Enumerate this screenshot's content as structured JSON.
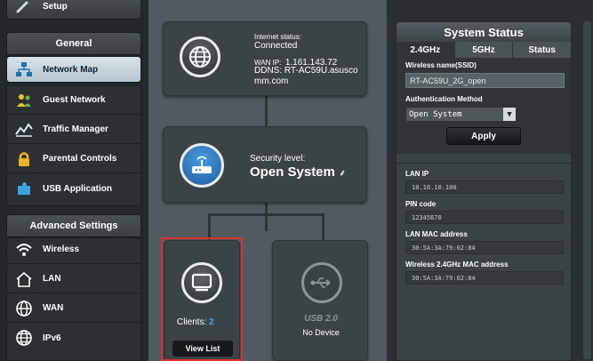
{
  "sidebar": {
    "setup_label": "Setup",
    "general_header": "General",
    "general_items": [
      {
        "label": "Network Map",
        "icon": "network-map-icon"
      },
      {
        "label": "Guest Network",
        "icon": "guest-network-icon"
      },
      {
        "label": "Traffic Manager",
        "icon": "traffic-manager-icon"
      },
      {
        "label": "Parental Controls",
        "icon": "parental-controls-icon"
      },
      {
        "label": "USB Application",
        "icon": "usb-application-icon"
      }
    ],
    "advanced_header": "Advanced Settings",
    "advanced_items": [
      {
        "label": "Wireless",
        "icon": "wireless-icon"
      },
      {
        "label": "LAN",
        "icon": "lan-icon"
      },
      {
        "label": "WAN",
        "icon": "wan-icon"
      },
      {
        "label": "IPv6",
        "icon": "ipv6-icon"
      }
    ]
  },
  "map": {
    "internet": {
      "status_label": "Internet status:",
      "status_value": "Connected",
      "wan_ip_label": "WAN IP:",
      "wan_ip_value": "1.161.143.72",
      "ddns_line1": "DDNS: RT-AC59U.asusco",
      "ddns_line2": "mm.com"
    },
    "router": {
      "security_label": "Security level:",
      "security_value": "Open System"
    },
    "clients": {
      "label": "Clients:",
      "count": "2",
      "view_list_label": "View List"
    },
    "usb": {
      "badge": "USB 2.0",
      "status": "No Device"
    }
  },
  "status": {
    "title": "System Status",
    "tabs": [
      "2.4GHz",
      "5GHz",
      "Status"
    ],
    "ssid_label": "Wireless name(SSID)",
    "ssid_value": "RT-AC59U_2G_open",
    "auth_label": "Authentication Method",
    "auth_value": "Open System",
    "apply_label": "Apply",
    "lan_ip_label": "LAN IP",
    "lan_ip_value": "10.10.10.100",
    "pin_label": "PIN code",
    "pin_value": "12345670",
    "lan_mac_label": "LAN MAC address",
    "lan_mac_value": "30:5A:3A:79:62:84",
    "wl_mac_label": "Wireless 2.4GHz MAC address",
    "wl_mac_value": "30:5A:3A:79:62:84"
  },
  "colors": {
    "accent_blue": "#2f8fd8",
    "highlight_red": "#e0302b",
    "clients_count": "#3fa9f5"
  }
}
